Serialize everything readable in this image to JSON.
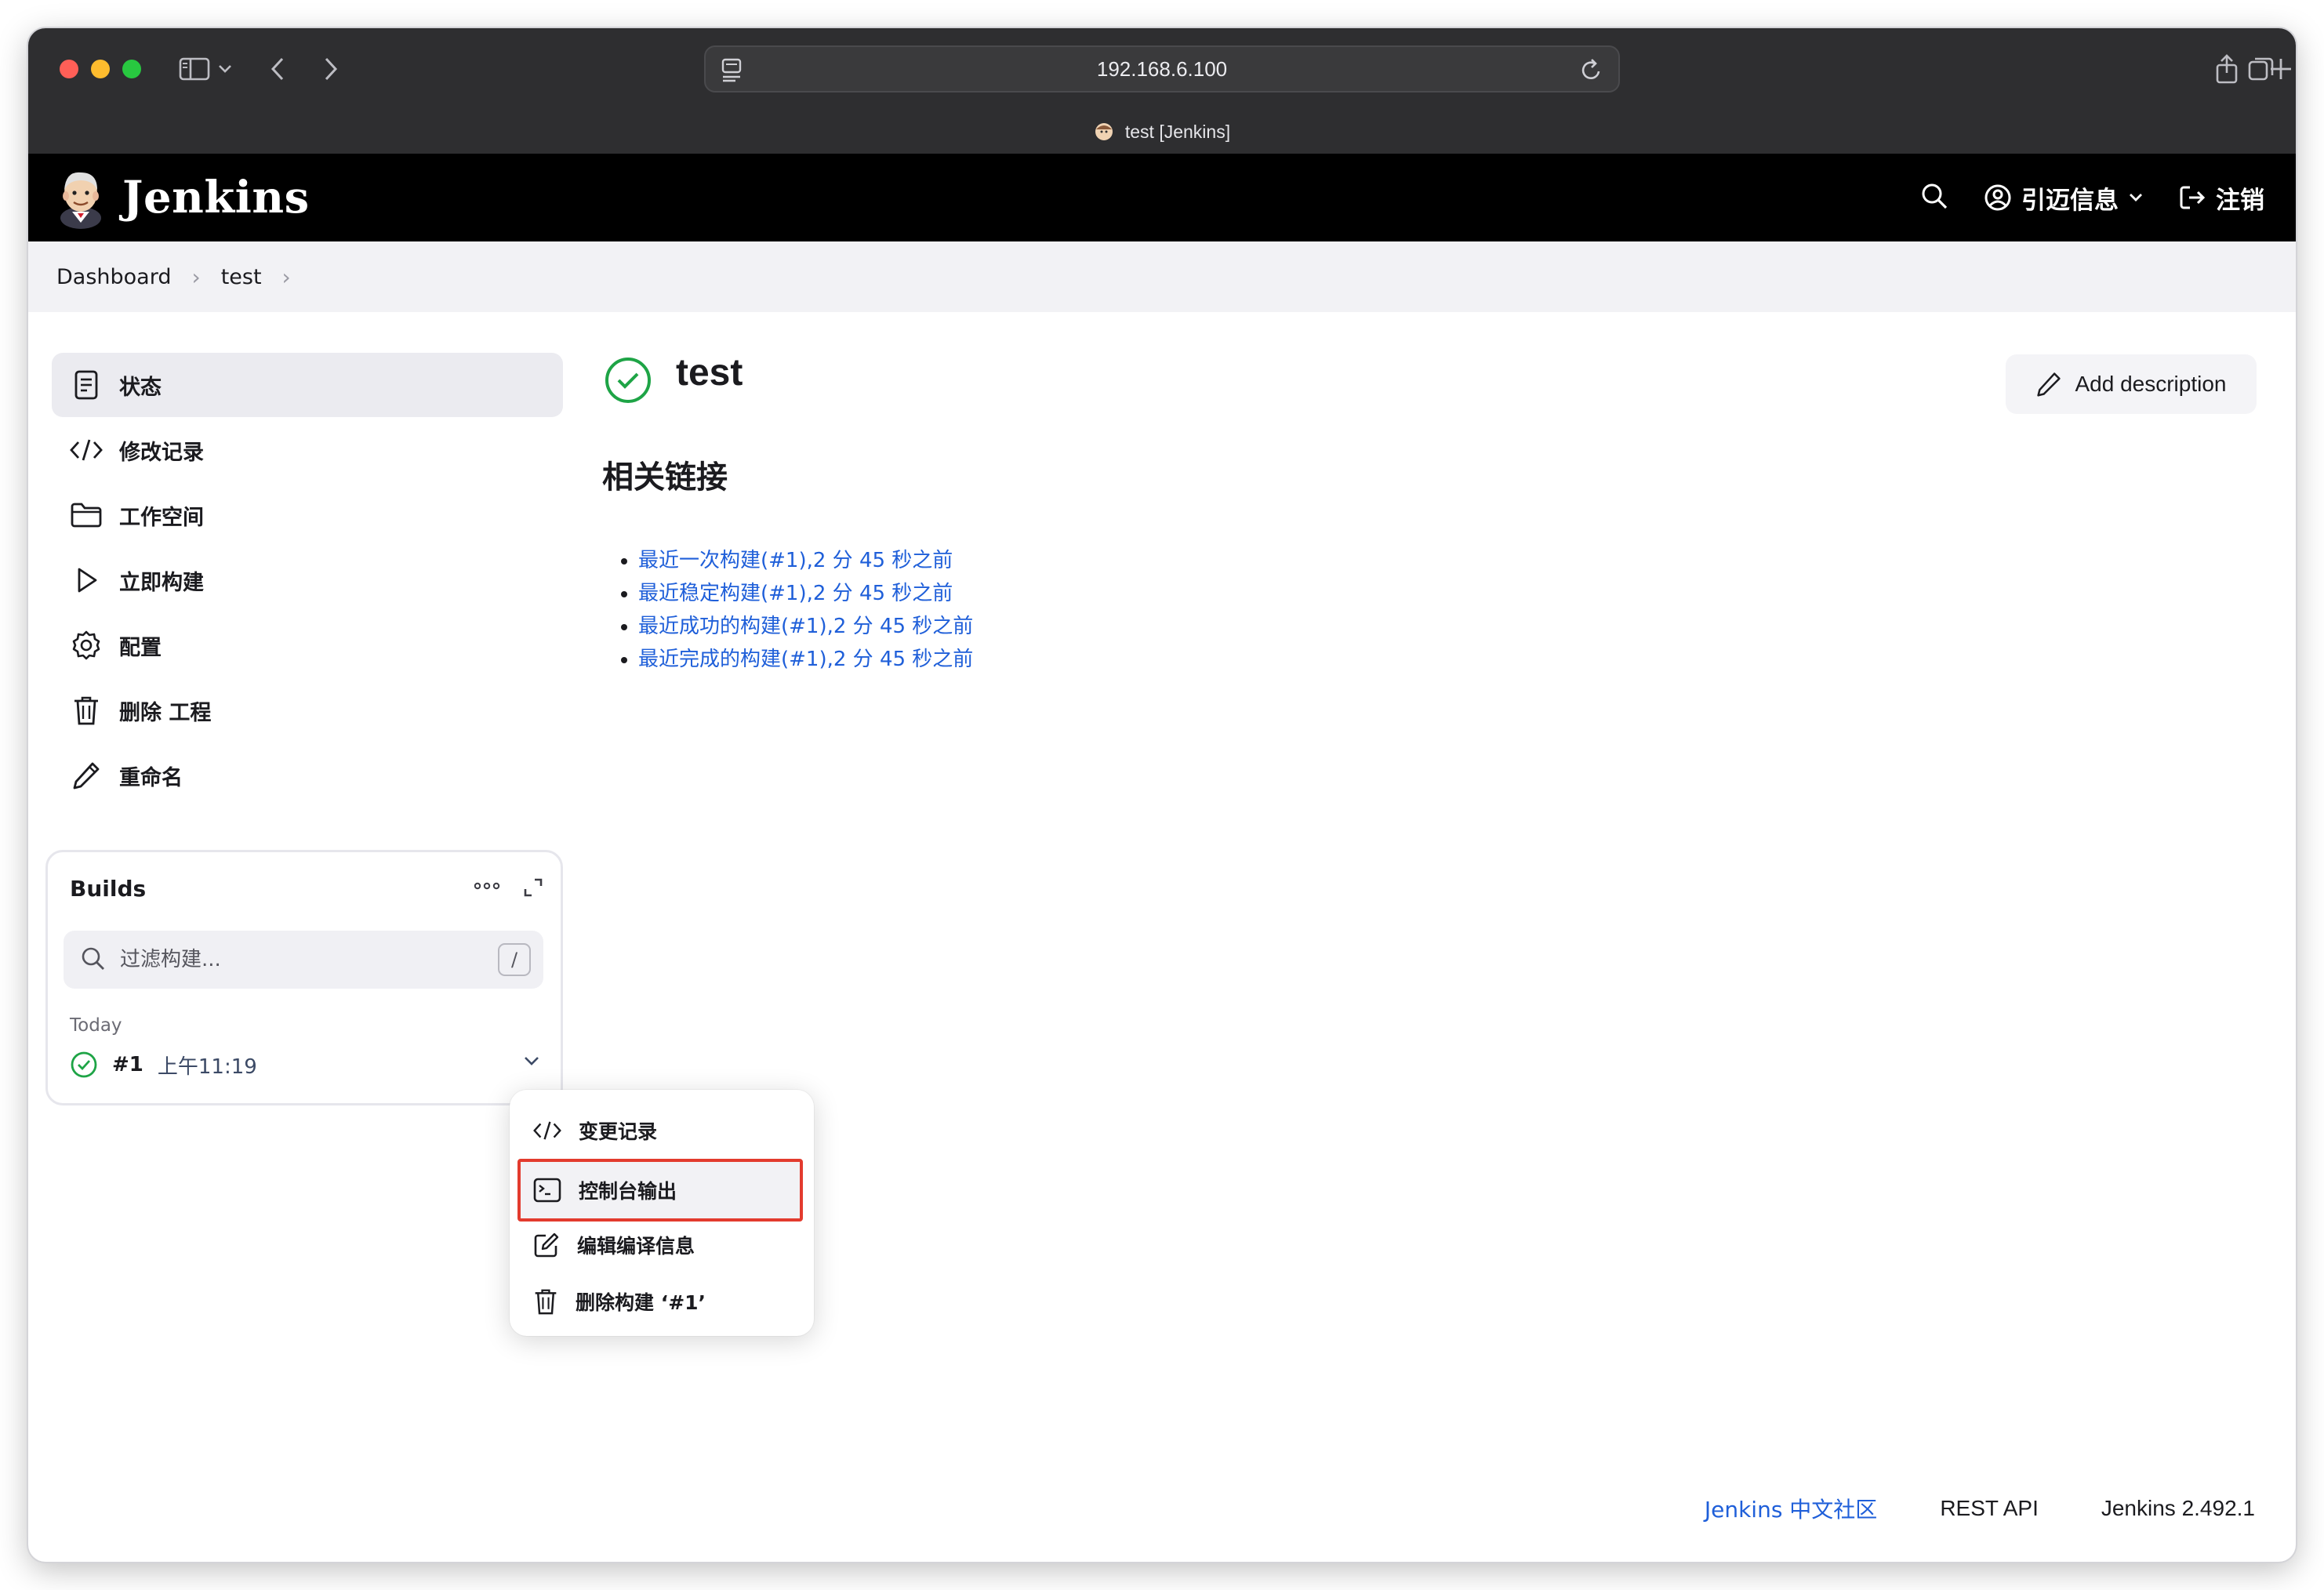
{
  "browser": {
    "address": "192.168.6.100",
    "tab_title": "test [Jenkins]"
  },
  "header": {
    "brand": "Jenkins",
    "user_label": "引迈信息",
    "logout_label": "注销"
  },
  "breadcrumb": [
    "Dashboard",
    "test"
  ],
  "sidebar": {
    "items": [
      {
        "label": "状态",
        "icon": "notepad-icon"
      },
      {
        "label": "修改记录",
        "icon": "code-icon"
      },
      {
        "label": "工作空间",
        "icon": "folder-icon"
      },
      {
        "label": "立即构建",
        "icon": "play-icon"
      },
      {
        "label": "配置",
        "icon": "gear-icon"
      },
      {
        "label": "删除 工程",
        "icon": "trash-icon"
      },
      {
        "label": "重命名",
        "icon": "pencil-icon"
      }
    ]
  },
  "builds": {
    "title": "Builds",
    "filter_placeholder": "过滤构建...",
    "shortcut_key": "/",
    "group_label": "Today",
    "rows": [
      {
        "number": "#1",
        "time": "上午11:19",
        "status": "success"
      }
    ]
  },
  "main": {
    "title": "test",
    "add_description": "Add description",
    "section_heading": "相关链接",
    "links": [
      "最近一次构建(#1),2 分 45 秒之前",
      "最近稳定构建(#1),2 分 45 秒之前",
      "最近成功的构建(#1),2 分 45 秒之前",
      "最近完成的构建(#1),2 分 45 秒之前"
    ]
  },
  "build_menu": {
    "items": [
      {
        "label": "变更记录",
        "icon": "code-icon",
        "highlighted": false
      },
      {
        "label": "控制台输出",
        "icon": "terminal-icon",
        "highlighted": true
      },
      {
        "label": "编辑编译信息",
        "icon": "edit-icon",
        "highlighted": false
      },
      {
        "label": "删除构建 ‘#1’",
        "icon": "trash-icon",
        "highlighted": false
      }
    ]
  },
  "footer": {
    "community": "Jenkins 中文社区",
    "rest_api": "REST API",
    "version": "Jenkins 2.492.1"
  },
  "colors": {
    "link": "#1f5fd9",
    "success": "#1ea446",
    "highlight_border": "#e33b2e",
    "header_bg": "#000000"
  }
}
